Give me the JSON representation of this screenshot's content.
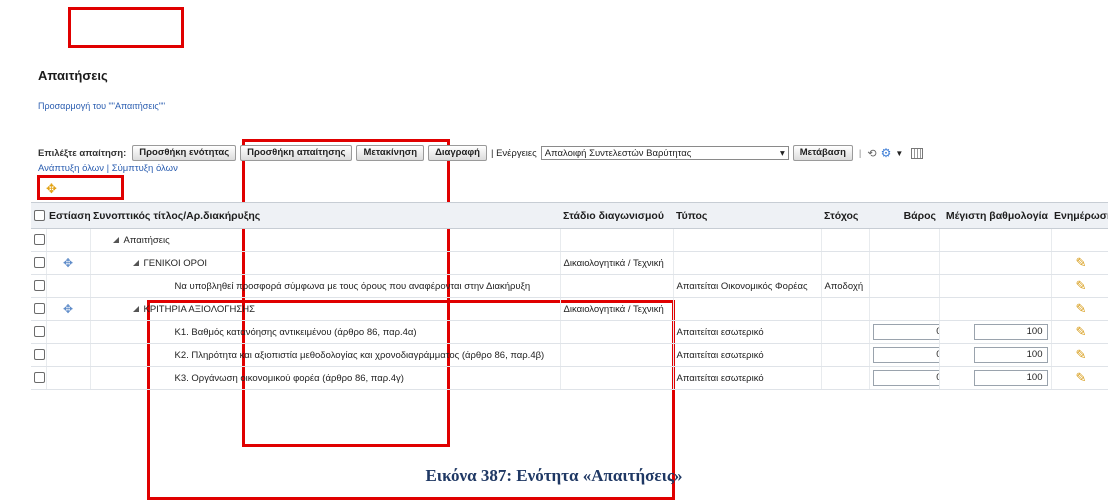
{
  "page": {
    "title": "Απαιτήσεις",
    "personalize_link": "Προσαρμογή του \"\"Απαιτήσεις\"\""
  },
  "toolbar": {
    "select_label": "Επιλέξτε απαίτηση:",
    "add_section": "Προσθήκη ενότητας",
    "add_requirement": "Προσθήκη απαίτησης",
    "move": "Μετακίνηση",
    "delete": "Διαγραφή",
    "actions_label": "| Ενέργειες",
    "actions_value": "Απαλοιφή Συντελεστών Βαρύτητας",
    "go": "Μετάβαση",
    "chevron": "▾"
  },
  "expand": {
    "expand_all": "Ανάπτυξη όλων",
    "sep": "|",
    "collapse_all": "Σύμπτυξη όλων"
  },
  "table": {
    "headers": [
      "Εστίαση",
      "Συνοπτικός τίτλος/Αρ.διακήρυξης",
      "Στάδιο διαγωνισμού",
      "Τύπος",
      "Στόχος",
      "Βάρος",
      "Μέγιστη βαθμολογία",
      "Ενημέρωση"
    ],
    "rows": [
      {
        "title": "Απαιτήσεις",
        "stage": "",
        "type": "",
        "target": "",
        "weight": "",
        "max": ""
      },
      {
        "title": "ΓΕΝΙΚΟΙ ΟΡΟΙ",
        "stage": "Δικαιολογητικά / Τεχνική",
        "type": "",
        "target": "",
        "weight": "",
        "max": ""
      },
      {
        "title": "Να υποβληθεί προσφορά σύμφωνα με τους όρους που αναφέρονται στην Διακήρυξη",
        "stage": "",
        "type": "Απαιτείται Οικονομικός Φορέας",
        "target": "Αποδοχή",
        "weight": "",
        "max": ""
      },
      {
        "title": "ΚΡΙΤΗΡΙΑ ΑΞΙΟΛΟΓΗΣΗΣ",
        "stage": "Δικαιολογητικά / Τεχνική",
        "type": "",
        "target": "",
        "weight": "",
        "max": ""
      },
      {
        "title": "Κ1. Βαθμός κατανόησης αντικειμένου (άρθρο 86, παρ.4α)",
        "stage": "",
        "type": "Απαιτείται εσωτερικό",
        "target": "",
        "weight": "0",
        "max": "100"
      },
      {
        "title": "Κ2. Πληρότητα και αξιοπιστία μεθοδολογίας και χρονοδιαγράμματος (άρθρο 86, παρ.4β)",
        "stage": "",
        "type": "Απαιτείται εσωτερικό",
        "target": "",
        "weight": "0",
        "max": "100"
      },
      {
        "title": "Κ3. Οργάνωση οικονομικού φορέα (άρθρο 86, παρ.4γ)",
        "stage": "",
        "type": "Απαιτείται εσωτερικό",
        "target": "",
        "weight": "0",
        "max": "100"
      }
    ]
  },
  "caption": "Εικόνα 387: Ενότητα «Απαιτήσεις»",
  "colors": {
    "highlight": "#e00000",
    "link": "#2a5db0",
    "caption": "#1f3864"
  }
}
